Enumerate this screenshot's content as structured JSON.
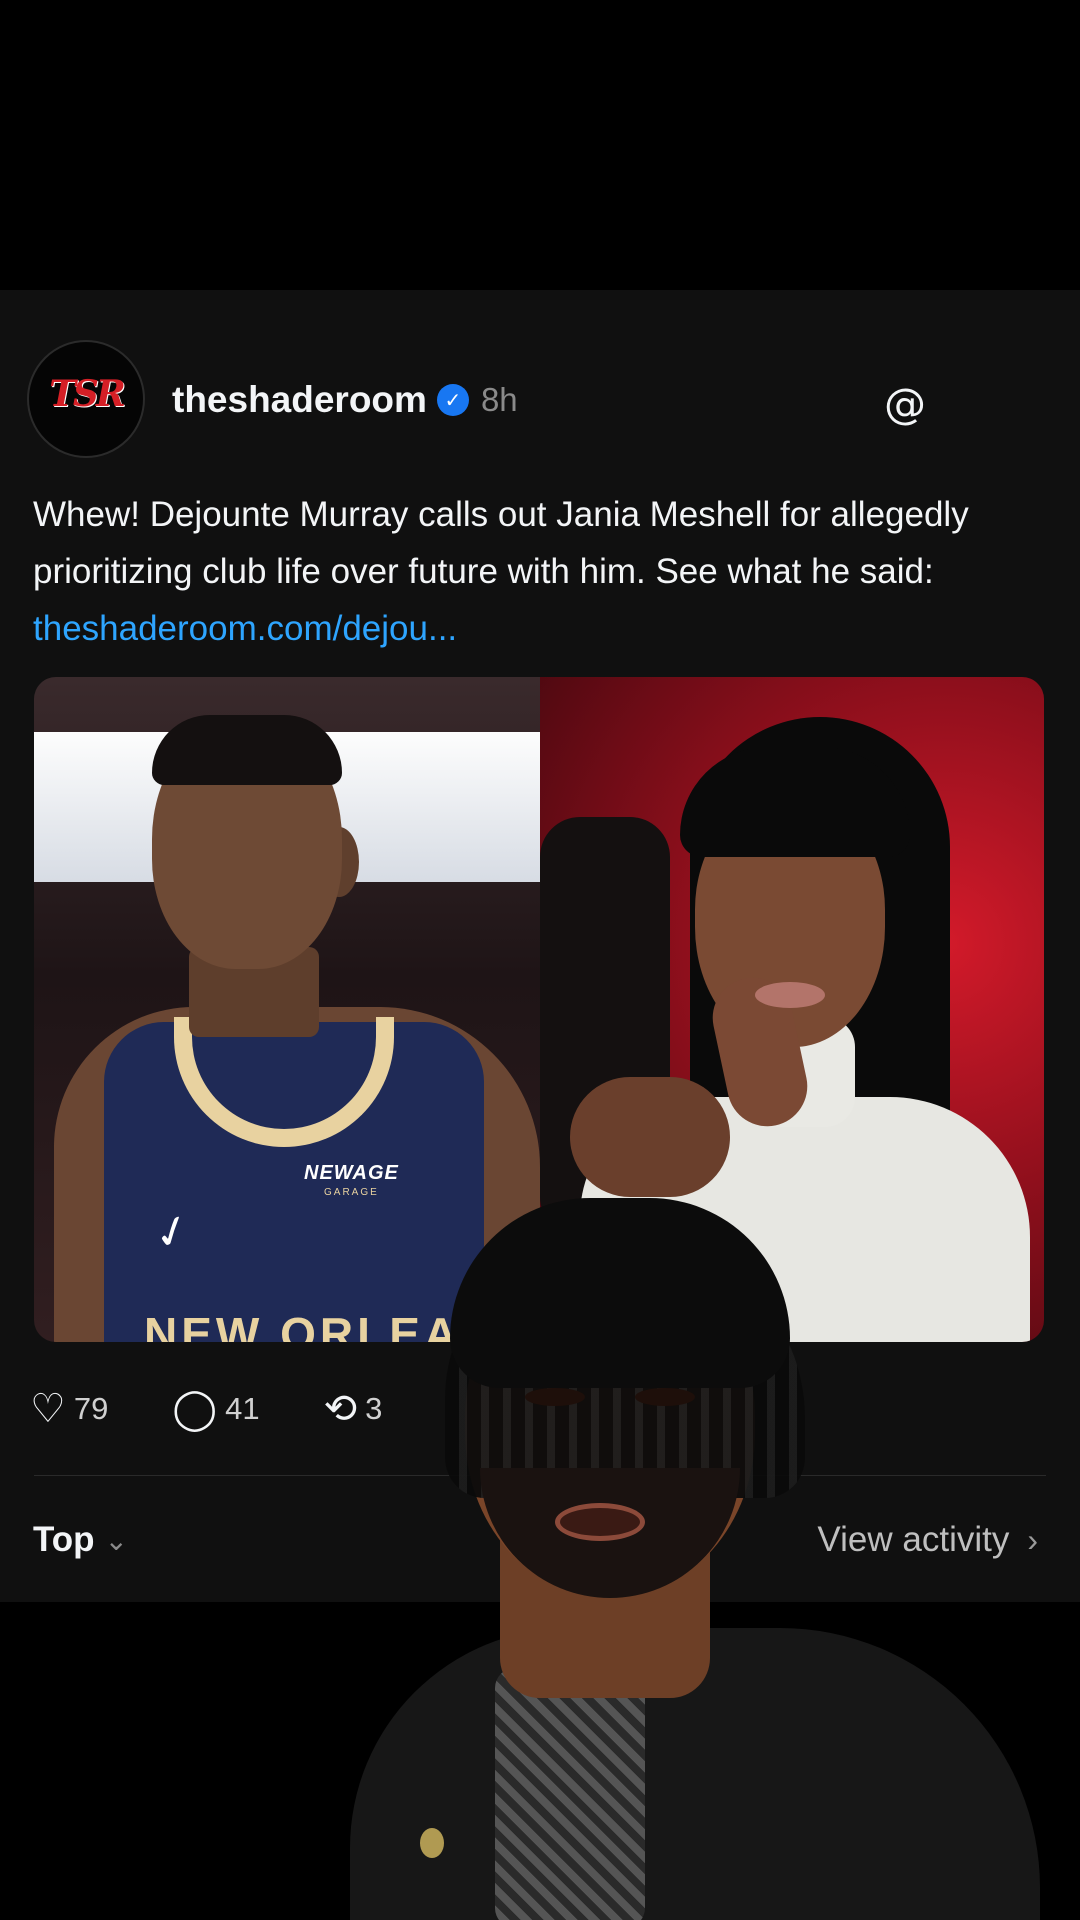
{
  "post": {
    "username": "theshaderoom",
    "timestamp": "8h",
    "avatar_label": "TSR",
    "caption_text": "Whew! Dejounte Murray calls out Jania Meshell for allegedly prioritizing club life over future with him. See what he said: ",
    "caption_link": "theshaderoom.com/dejou...",
    "image_text": {
      "sponsor": "NEWAGE",
      "sponsor_sub": "GARAGE",
      "jersey_text": "NEW ORLEANS"
    }
  },
  "icons": {
    "verified": "verified-badge-icon",
    "threads": "threads-logo-icon",
    "like": "heart-icon",
    "reply": "comment-icon",
    "repost": "repost-icon",
    "sort_chevron": "chevron-down-icon",
    "activity_chevron": "chevron-right-icon"
  },
  "actions": {
    "likes": "79",
    "replies": "41",
    "reposts": "3"
  },
  "footer": {
    "sort_label": "Top",
    "activity_label": "View activity"
  },
  "colors": {
    "background": "#000000",
    "card": "#101010",
    "link": "#2ea5ff",
    "verified": "#1877f2",
    "brand_red": "#d51f26"
  }
}
